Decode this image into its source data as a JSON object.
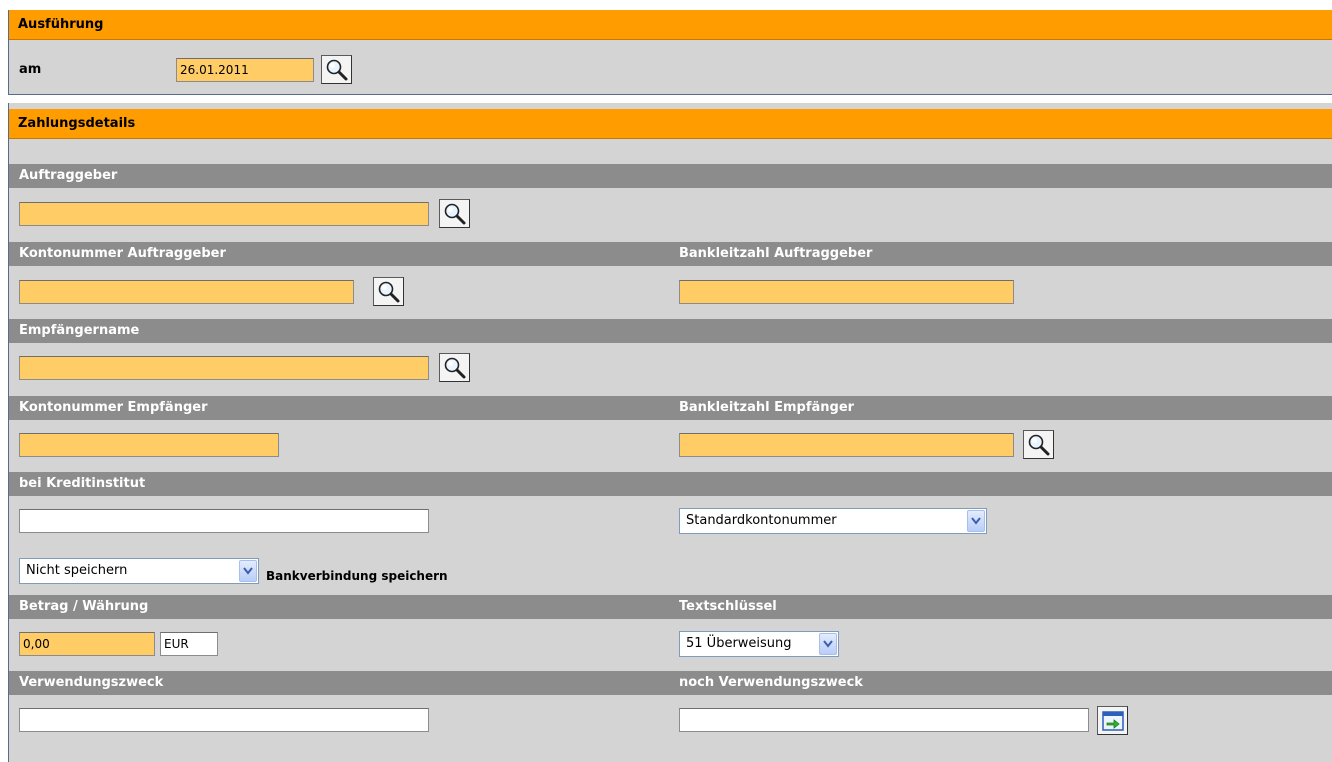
{
  "execution": {
    "title": "Ausführung",
    "date_label": "am",
    "date_value": "26.01.2011"
  },
  "payment": {
    "title": "Zahlungsdetails",
    "principal": {
      "label": "Auftraggeber",
      "value": ""
    },
    "principal_account": {
      "label": "Kontonummer Auftraggeber",
      "value": ""
    },
    "principal_bank_code": {
      "label": "Bankleitzahl Auftraggeber",
      "value": ""
    },
    "recipient_name": {
      "label": "Empfängername",
      "value": ""
    },
    "recipient_account": {
      "label": "Kontonummer Empfänger",
      "value": ""
    },
    "recipient_bank_code": {
      "label": "Bankleitzahl Empfänger",
      "value": ""
    },
    "bank": {
      "label": "bei Kreditinstitut",
      "value": ""
    },
    "account_type_select": {
      "value": "Standardkontonummer"
    },
    "save_select": {
      "value": "Nicht speichern",
      "label": "Bankverbindung speichern"
    },
    "amount": {
      "label": "Betrag / Währung",
      "value": "0,00",
      "currency": "EUR"
    },
    "text_key": {
      "label": "Textschlüssel",
      "value": "51 Überweisung"
    },
    "purpose": {
      "label": "Verwendungszweck",
      "value": ""
    },
    "purpose_more": {
      "label": "noch Verwendungszweck",
      "value": ""
    }
  },
  "icons": {
    "lookup": "magnifier-icon",
    "add_line": "green-arrow-icon"
  },
  "colors": {
    "section_header": "#ff9c00",
    "subsection_header": "#8c8c8c",
    "panel_background": "#d4d4d4",
    "required_field": "#ffcc66"
  }
}
